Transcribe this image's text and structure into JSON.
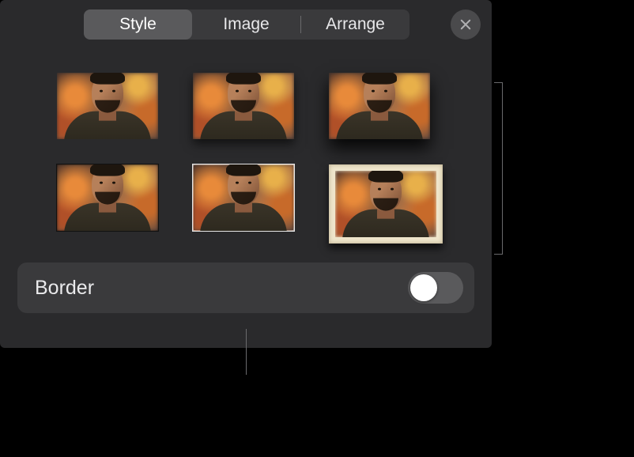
{
  "tabs": {
    "style": "Style",
    "image": "Image",
    "arrange": "Arrange"
  },
  "border": {
    "label": "Border",
    "enabled": false
  },
  "style_presets": [
    {
      "id": "none",
      "name": "No effect"
    },
    {
      "id": "shadow-soft",
      "name": "Soft shadow"
    },
    {
      "id": "shadow-strong",
      "name": "Strong shadow"
    },
    {
      "id": "frame-black",
      "name": "Thin black frame"
    },
    {
      "id": "frame-white",
      "name": "Thin white frame"
    },
    {
      "id": "photo-frame",
      "name": "Paper photo frame"
    }
  ]
}
